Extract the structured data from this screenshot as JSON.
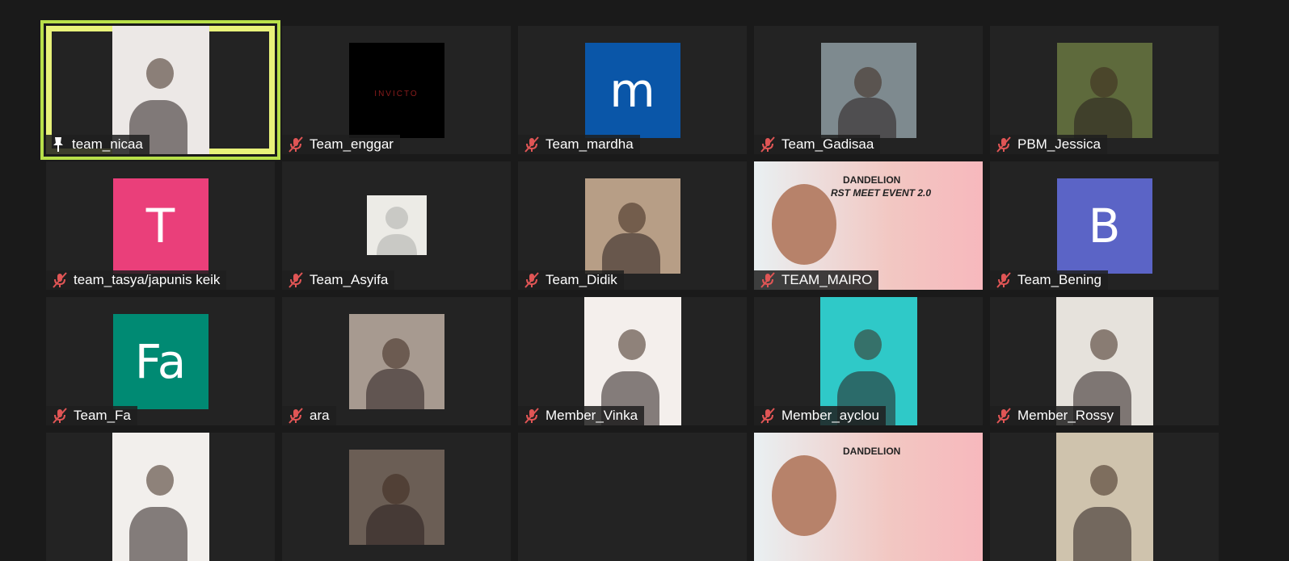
{
  "participants": [
    {
      "name": "team_nicaa",
      "type": "video",
      "muted": false,
      "pinned": true,
      "active": true,
      "bg": "#ece8e6"
    },
    {
      "name": "Team_enggar",
      "type": "image",
      "muted": true,
      "bg": "#000000",
      "logo_text": "INVICTO"
    },
    {
      "name": "Team_mardha",
      "type": "avatar",
      "muted": true,
      "initial": "m",
      "bg": "#0a56a8"
    },
    {
      "name": "Team_Gadisaa",
      "type": "image",
      "muted": true,
      "bg": "#7e8a8f"
    },
    {
      "name": "PBM_Jessica",
      "type": "image",
      "muted": true,
      "bg": "#5e6a3c"
    },
    {
      "name": "team_tasya/japunis keik",
      "type": "avatar",
      "muted": true,
      "initial": "T",
      "bg": "#ea3f7a"
    },
    {
      "name": "Team_Asyifa",
      "type": "placeholder",
      "muted": true,
      "bg": "#ecebe6"
    },
    {
      "name": "Team_Didik",
      "type": "image",
      "muted": true,
      "bg": "#b79e86"
    },
    {
      "name": "TEAM_MAIRO",
      "type": "video_wide",
      "muted": true,
      "bg": "#f2c7c2",
      "banner_line1": "DANDELION",
      "banner_line2": "RST MEET EVENT 2.0"
    },
    {
      "name": "Team_Bening",
      "type": "avatar",
      "muted": true,
      "initial": "B",
      "bg": "#5b64c6"
    },
    {
      "name": "Team_Fa",
      "type": "avatar",
      "muted": true,
      "initial": "Fa",
      "bg": "#008a73"
    },
    {
      "name": "ara",
      "type": "image",
      "muted": true,
      "bg": "#a79a90"
    },
    {
      "name": "Member_Vinka",
      "type": "video",
      "muted": true,
      "bg": "#f4efec"
    },
    {
      "name": "Member_ayclou",
      "type": "video",
      "muted": true,
      "bg": "#2fc9c8"
    },
    {
      "name": "Member_Rossy",
      "type": "video",
      "muted": true,
      "bg": "#e6e2dc"
    },
    {
      "name": "",
      "type": "video",
      "muted": true,
      "bg": "#f2efec",
      "partial": true
    },
    {
      "name": "",
      "type": "image",
      "muted": true,
      "bg": "#6b5e55",
      "partial": true
    },
    {
      "name": "",
      "type": "empty",
      "muted": true,
      "bg": "#232323",
      "partial": true
    },
    {
      "name": "",
      "type": "video_wide",
      "muted": true,
      "bg": "#f2c7c2",
      "partial": true,
      "banner_line1": "DANDELION"
    },
    {
      "name": "",
      "type": "video",
      "muted": true,
      "bg": "#cfc3ad",
      "partial": true
    }
  ]
}
